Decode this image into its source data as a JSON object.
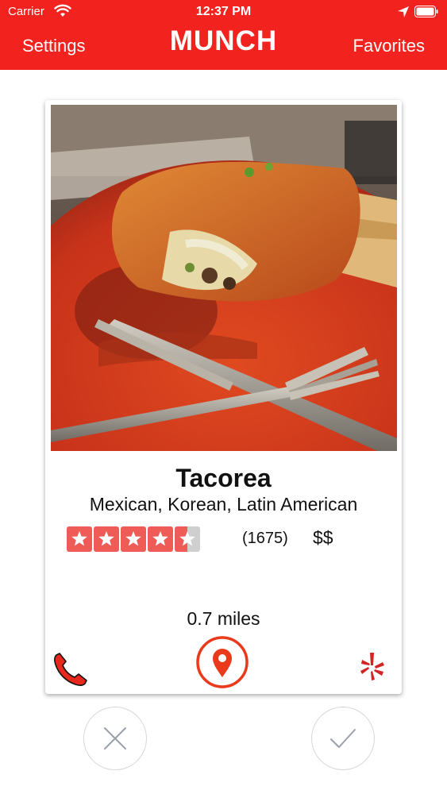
{
  "status": {
    "carrier": "Carrier",
    "time": "12:37 PM",
    "icons": [
      "wifi-icon",
      "location-arrow-icon",
      "battery-icon"
    ]
  },
  "nav": {
    "left_label": "Settings",
    "title": "MUNCH",
    "right_label": "Favorites"
  },
  "restaurant": {
    "name": "Tacorea",
    "categories": "Mexican, Korean, Latin American",
    "rating": 4.5,
    "rating_max": 5,
    "review_count": "(1675)",
    "price": "$$",
    "distance": "0.7 miles",
    "photo_subject": "burrito plate with knife and fork"
  },
  "actions": {
    "call_icon": "phone-icon",
    "map_icon": "map-pin-icon",
    "yelp_icon": "yelp-icon",
    "reject_icon": "close-icon",
    "accept_icon": "checkmark-icon"
  },
  "colors": {
    "brand_red": "#f2231f",
    "star_fill": "#ef5b57",
    "star_empty": "#cfcfcf",
    "yelp_red": "#d32323",
    "button_gray": "#9aa0aa"
  }
}
